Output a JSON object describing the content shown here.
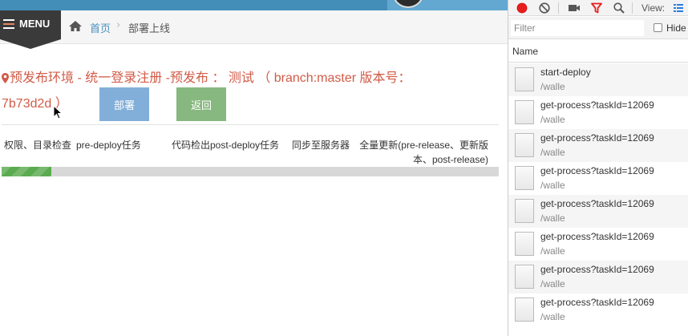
{
  "app": {
    "menu_label": "MENU",
    "breadcrumb": {
      "home": "首页",
      "separator": "›",
      "current": "部署上线"
    },
    "heading": "预发布环境 - 统一登录注册 -预发布 ： 测试 （ branch:master 版本号：7b73d2d ）",
    "buttons": {
      "deploy": "部署",
      "back": "返回"
    },
    "steps": [
      "权限、目录检查",
      "pre-deploy任务",
      "代码检出post-deploy任务",
      "同步至服务器",
      "全量更新(pre-release、更新版本、post-release)"
    ],
    "progress_fraction": 0.1,
    "colors": {
      "heading": "#d15b47",
      "deploy_button": "#82afd9",
      "back_button": "#87b87f",
      "progress": "#5aaa4f",
      "topbar": "#438eb9"
    }
  },
  "devtools": {
    "toolbar": {
      "icons": [
        "record-icon",
        "clear-icon",
        "video-icon",
        "filter-icon",
        "search-icon",
        "list-view-icon"
      ],
      "view_label": "View:"
    },
    "filter": {
      "placeholder": "Filter",
      "hide_label": "Hide"
    },
    "name_header": "Name",
    "requests": [
      {
        "name": "start-deploy",
        "path": "/walle"
      },
      {
        "name": "get-process?taskId=12069",
        "path": "/walle"
      },
      {
        "name": "get-process?taskId=12069",
        "path": "/walle"
      },
      {
        "name": "get-process?taskId=12069",
        "path": "/walle"
      },
      {
        "name": "get-process?taskId=12069",
        "path": "/walle"
      },
      {
        "name": "get-process?taskId=12069",
        "path": "/walle"
      },
      {
        "name": "get-process?taskId=12069",
        "path": "/walle"
      },
      {
        "name": "get-process?taskId=12069",
        "path": "/walle"
      }
    ]
  }
}
